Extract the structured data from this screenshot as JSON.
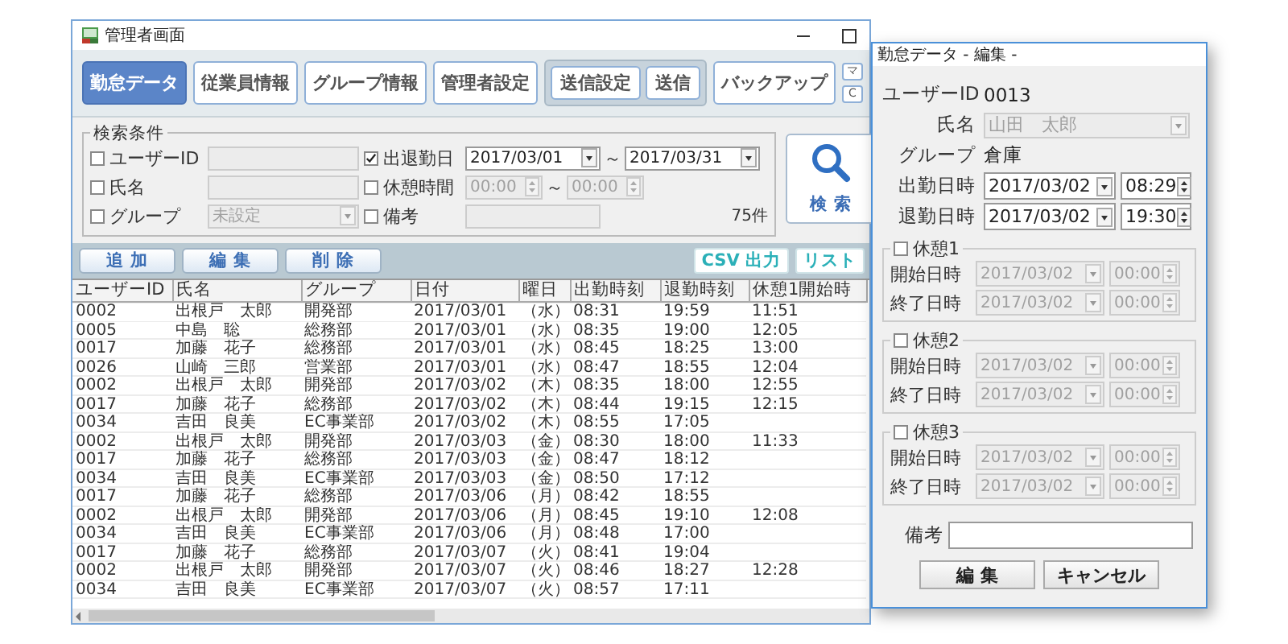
{
  "main_window": {
    "title": "管理者画面",
    "toolbar": [
      {
        "kind": "button",
        "label": "勤怠データ",
        "selected": true
      },
      {
        "kind": "button",
        "label": "従業員情報",
        "selected": false
      },
      {
        "kind": "button",
        "label": "グループ情報",
        "selected": false
      },
      {
        "kind": "button",
        "label": "管理者設定",
        "selected": false
      },
      {
        "kind": "group",
        "items": [
          "送信設定",
          "送信"
        ]
      },
      {
        "kind": "button",
        "label": "バックアップ",
        "selected": false
      },
      {
        "kind": "mini",
        "items": [
          "マ",
          "C"
        ]
      }
    ],
    "search": {
      "title": "検索条件",
      "left": [
        {
          "kind": "text",
          "label": "ユーザーID",
          "checked": false
        },
        {
          "kind": "text",
          "label": "氏名",
          "checked": false
        },
        {
          "kind": "select",
          "label": "グループ",
          "checked": false,
          "value": "未設定"
        }
      ],
      "right": [
        {
          "kind": "date_range",
          "label": "出退勤日",
          "checked": true,
          "from": "2017/03/01",
          "separator": "～",
          "to": "2017/03/31"
        },
        {
          "kind": "time_range",
          "label": "休憩時間",
          "checked": false,
          "from": "00:00",
          "separator": "～",
          "to": "00:00"
        },
        {
          "kind": "text",
          "label": "備考",
          "checked": false
        }
      ],
      "count": "75件",
      "button": "検 索"
    },
    "actions": [
      "追 加",
      "編 集",
      "削 除"
    ],
    "exports": [
      "CSV 出力",
      "リスト"
    ],
    "table": {
      "columns": [
        "ユーザーID",
        "氏名",
        "グループ",
        "日付",
        "曜日",
        "出勤時刻",
        "退勤時刻",
        "休憩1開始時"
      ],
      "rows": [
        [
          "0002",
          "出根戸　太郎",
          "開発部",
          "2017/03/01",
          "（水）",
          "08:31",
          "19:59",
          "11:51"
        ],
        [
          "0005",
          "中島　聡",
          "総務部",
          "2017/03/01",
          "（水）",
          "08:35",
          "19:00",
          "12:05"
        ],
        [
          "0017",
          "加藤　花子",
          "総務部",
          "2017/03/01",
          "（水）",
          "08:45",
          "18:25",
          "13:00"
        ],
        [
          "0026",
          "山崎　三郎",
          "営業部",
          "2017/03/01",
          "（水）",
          "08:47",
          "18:55",
          "12:04"
        ],
        [
          "0002",
          "出根戸　太郎",
          "開発部",
          "2017/03/02",
          "（木）",
          "08:35",
          "18:00",
          "12:55"
        ],
        [
          "0017",
          "加藤　花子",
          "総務部",
          "2017/03/02",
          "（木）",
          "08:44",
          "19:15",
          "12:15"
        ],
        [
          "0034",
          "吉田　良美",
          "EC事業部",
          "2017/03/02",
          "（木）",
          "08:55",
          "17:05",
          null
        ],
        [
          "0002",
          "出根戸　太郎",
          "開発部",
          "2017/03/03",
          "（金）",
          "08:30",
          "18:00",
          "11:33"
        ],
        [
          "0017",
          "加藤　花子",
          "総務部",
          "2017/03/03",
          "（金）",
          "08:47",
          "18:12",
          null
        ],
        [
          "0034",
          "吉田　良美",
          "EC事業部",
          "2017/03/03",
          "（金）",
          "08:50",
          "17:12",
          null
        ],
        [
          "0017",
          "加藤　花子",
          "総務部",
          "2017/03/06",
          "（月）",
          "08:42",
          "18:55",
          null
        ],
        [
          "0002",
          "出根戸　太郎",
          "開発部",
          "2017/03/06",
          "（月）",
          "08:45",
          "19:10",
          "12:08"
        ],
        [
          "0034",
          "吉田　良美",
          "EC事業部",
          "2017/03/06",
          "（月）",
          "08:48",
          "17:00",
          null
        ],
        [
          "0017",
          "加藤　花子",
          "総務部",
          "2017/03/07",
          "（火）",
          "08:41",
          "19:04",
          null
        ],
        [
          "0002",
          "出根戸　太郎",
          "開発部",
          "2017/03/07",
          "（火）",
          "08:46",
          "18:27",
          "12:28"
        ],
        [
          "0034",
          "吉田　良美",
          "EC事業部",
          "2017/03/07",
          "（火）",
          "08:57",
          "17:11",
          null
        ]
      ]
    }
  },
  "dialog": {
    "title": "勤怠データ - 編集 -",
    "user_id_label": "ユーザーID",
    "user_id": "0013",
    "name_label": "氏名",
    "name": "山田　太郎",
    "name_disabled": true,
    "group_label": "グループ",
    "group": "倉庫",
    "times": [
      {
        "label": "出勤日時",
        "date": "2017/03/02",
        "time": "08:29"
      },
      {
        "label": "退勤日時",
        "date": "2017/03/02",
        "time": "19:30"
      }
    ],
    "breaks": [
      {
        "title": "休憩1",
        "checked": false,
        "rows": [
          {
            "label": "開始日時",
            "date": "2017/03/02",
            "time": "00:00"
          },
          {
            "label": "終了日時",
            "date": "2017/03/02",
            "time": "00:00"
          }
        ]
      },
      {
        "title": "休憩2",
        "checked": false,
        "rows": [
          {
            "label": "開始日時",
            "date": "2017/03/02",
            "time": "00:00"
          },
          {
            "label": "終了日時",
            "date": "2017/03/02",
            "time": "00:00"
          }
        ]
      },
      {
        "title": "休憩3",
        "checked": false,
        "rows": [
          {
            "label": "開始日時",
            "date": "2017/03/02",
            "time": "00:00"
          },
          {
            "label": "終了日時",
            "date": "2017/03/02",
            "time": "00:00"
          }
        ]
      }
    ],
    "memo_label": "備考",
    "buttons": [
      "編 集",
      "キャンセル"
    ]
  }
}
